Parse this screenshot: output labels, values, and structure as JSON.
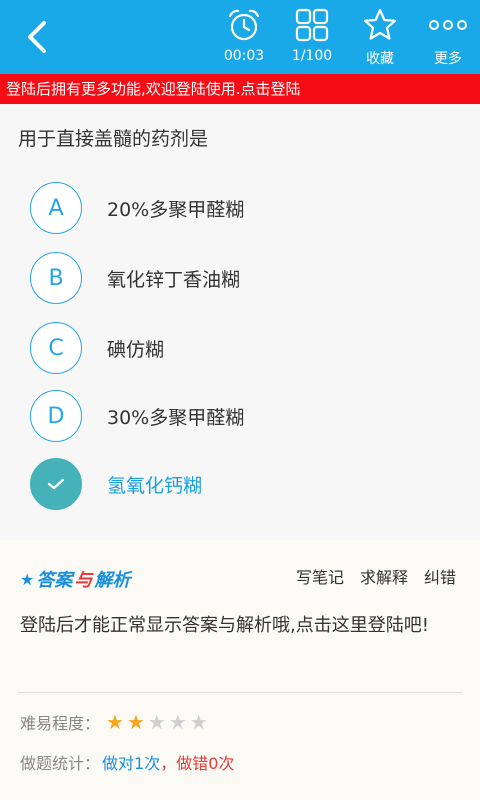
{
  "toolbar": {
    "timer": "00:03",
    "progress": "1/100",
    "favorite_label": "收藏",
    "more_label": "更多"
  },
  "banner": {
    "text": "登陆后拥有更多功能,欢迎登陆使用.点击登陆"
  },
  "question": {
    "text": "用于直接盖髓的药剂是",
    "options": [
      {
        "letter": "A",
        "text": "20%多聚甲醛糊",
        "correct": false
      },
      {
        "letter": "B",
        "text": "氧化锌丁香油糊",
        "correct": false
      },
      {
        "letter": "C",
        "text": "碘仿糊",
        "correct": false
      },
      {
        "letter": "D",
        "text": "30%多聚甲醛糊",
        "correct": false
      },
      {
        "letter": "",
        "text": "氢氧化钙糊",
        "correct": true
      }
    ]
  },
  "answer": {
    "title_part1": "答案",
    "title_part2": "与",
    "title_part3": "解析",
    "actions": [
      "写笔记",
      "求解释",
      "纠错"
    ],
    "message": "登陆后才能正常显示答案与解析哦,点击这里登陆吧!",
    "difficulty_label": "难易程度：",
    "difficulty_rating": 2,
    "difficulty_max": 5,
    "stats_label": "做题统计：",
    "stats_right": "做对1次",
    "stats_sep": "，",
    "stats_wrong": "做错0次"
  },
  "colors": {
    "accent": "#1aa9e8",
    "banner": "#f50c14",
    "correct": "#45b2b9",
    "star": "#f5a623"
  }
}
